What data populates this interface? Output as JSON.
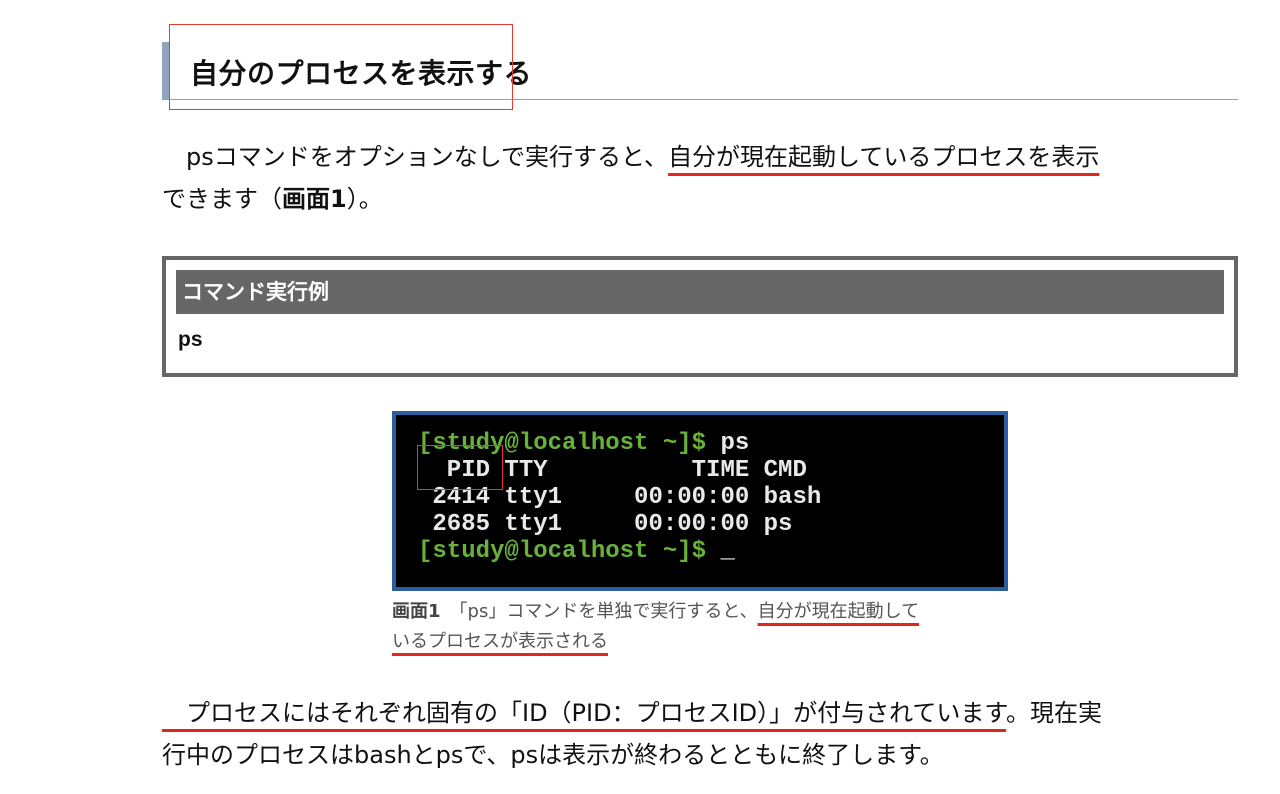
{
  "heading": {
    "text": "自分のプロセスを表示する"
  },
  "intro": {
    "line1_before": "　psコマンドをオプションなしで実行すると、",
    "line1_highlight": "自分が現在起動しているプロセスを表示",
    "line2_before": "できます（",
    "line2_bold": "画面1",
    "line2_after": "）。"
  },
  "command_box": {
    "header": "コマンド実行例",
    "command": "ps"
  },
  "terminal": {
    "line1_prompt": "[study@localhost ~]$",
    "line1_cmd": " ps",
    "line2": "  PID TTY          TIME CMD",
    "line3": " 2414 tty1     00:00:00 bash",
    "line4": " 2685 tty1     00:00:00 ps",
    "line5_prompt": "[study@localhost ~]$",
    "line5_cursor": " _"
  },
  "caption": {
    "label": "画面1",
    "before": "　「ps」コマンドを単独で実行すると、",
    "highlight1": "自分が現在起動して",
    "highlight2": "いるプロセスが表示される"
  },
  "outro": {
    "line1_highlight": "　プロセスにはそれぞれ固有の「ID（PID：プロセスID）」が付与されています",
    "line1_after": "。現在実",
    "line2": "行中のプロセスはbashとpsで、psは表示が終わるとともに終了します。"
  },
  "colors": {
    "highlight_red": "#e2261c",
    "terminal_green": "#69b23a",
    "terminal_border": "#2c5f9e"
  }
}
